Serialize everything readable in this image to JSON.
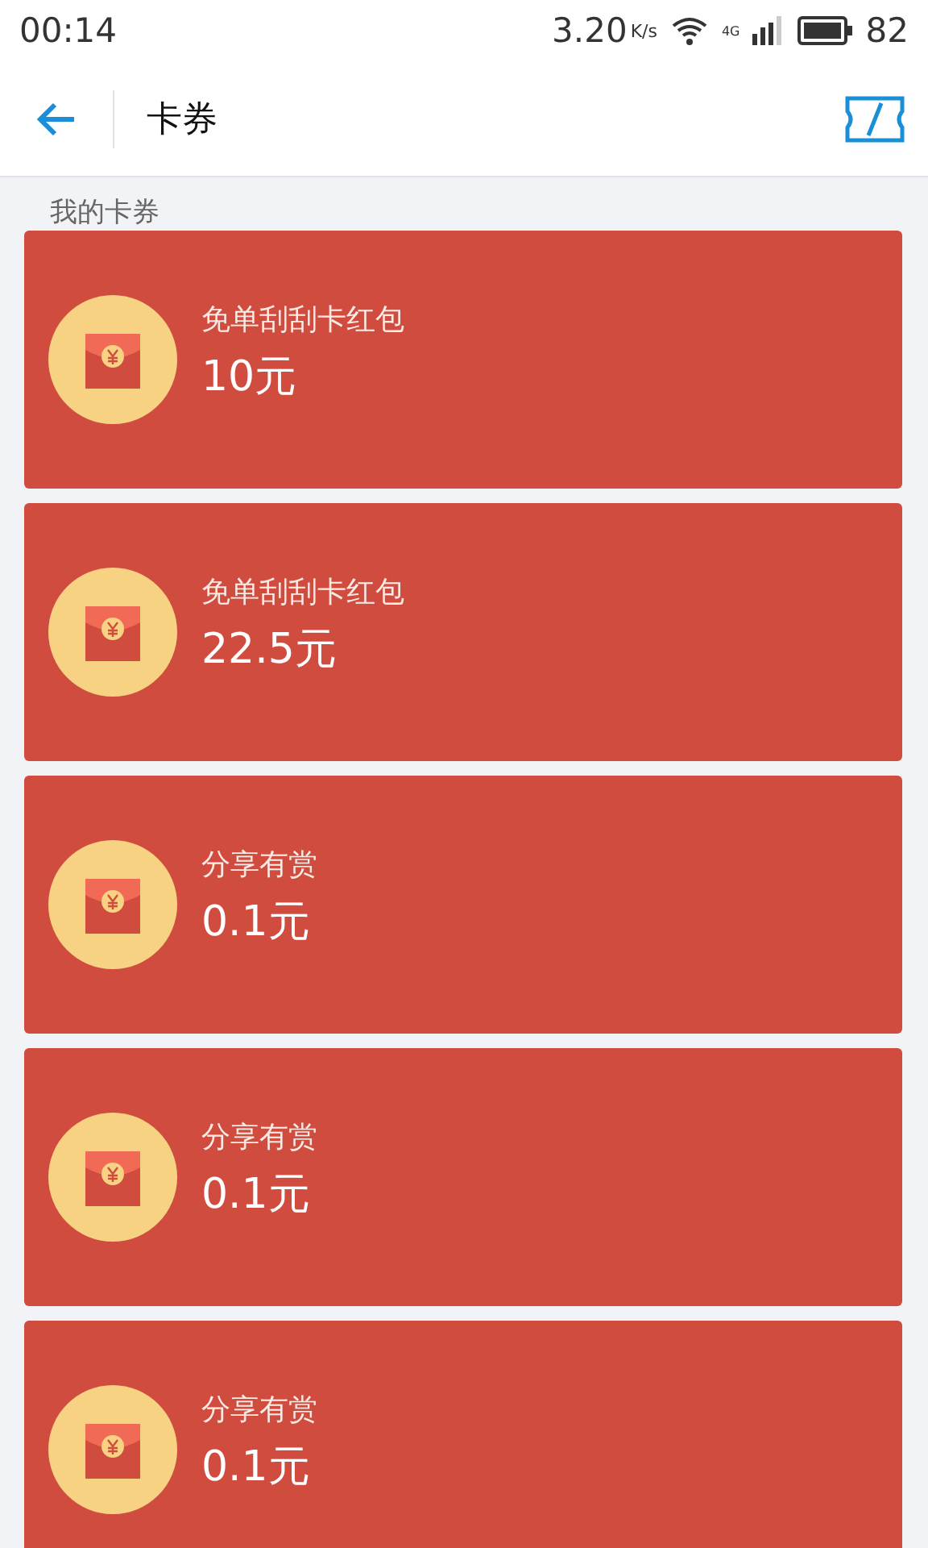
{
  "status_bar": {
    "time": "00:14",
    "speed": "3.20",
    "speed_unit": "K/s",
    "network": "4G",
    "battery": "82"
  },
  "header": {
    "title": "卡券"
  },
  "section": {
    "title": "我的卡券"
  },
  "cards": [
    {
      "name": "免单刮刮卡红包",
      "amount": "10元"
    },
    {
      "name": "免单刮刮卡红包",
      "amount": "22.5元"
    },
    {
      "name": "分享有赏",
      "amount": "0.1元"
    },
    {
      "name": "分享有赏",
      "amount": "0.1元"
    },
    {
      "name": "分享有赏",
      "amount": "0.1元"
    }
  ]
}
